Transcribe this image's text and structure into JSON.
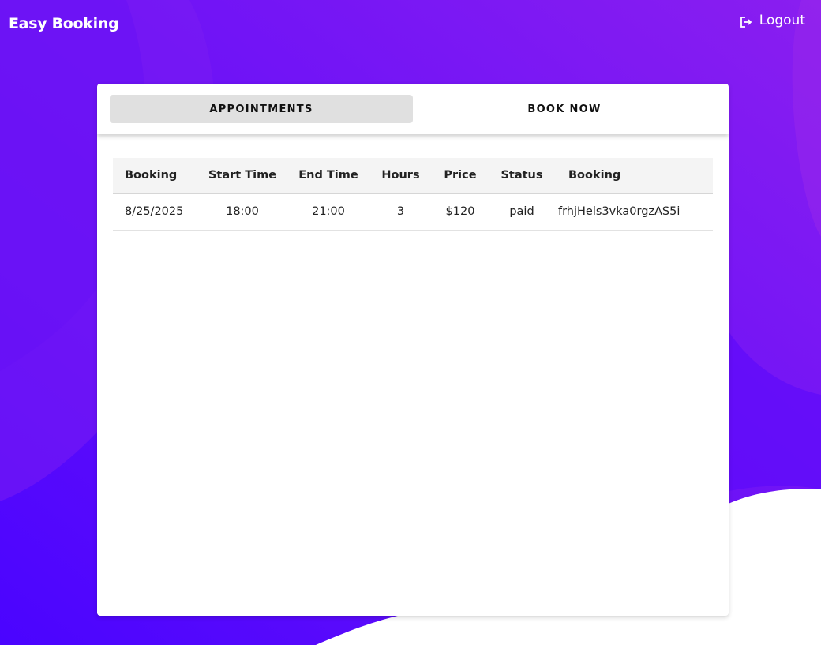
{
  "header": {
    "app_title": "Easy Booking",
    "logout_label": "Logout",
    "logout_icon": "logout-icon"
  },
  "tabs": [
    {
      "label": "APPOINTMENTS",
      "active": true
    },
    {
      "label": "BOOK NOW",
      "active": false
    }
  ],
  "table": {
    "columns": [
      "Booking",
      "Start Time",
      "End Time",
      "Hours",
      "Price",
      "Status",
      "Booking"
    ],
    "rows": [
      [
        "8/25/2025",
        "18:00",
        "21:00",
        "3",
        "$120",
        "paid",
        "frhjHels3vka0rgzAS5i"
      ]
    ]
  },
  "colors": {
    "brand_purple": "#6a12f5",
    "deep_purple": "#4a04ff",
    "tab_active_bg": "#e0e0e0",
    "card_bg": "#ffffff"
  }
}
